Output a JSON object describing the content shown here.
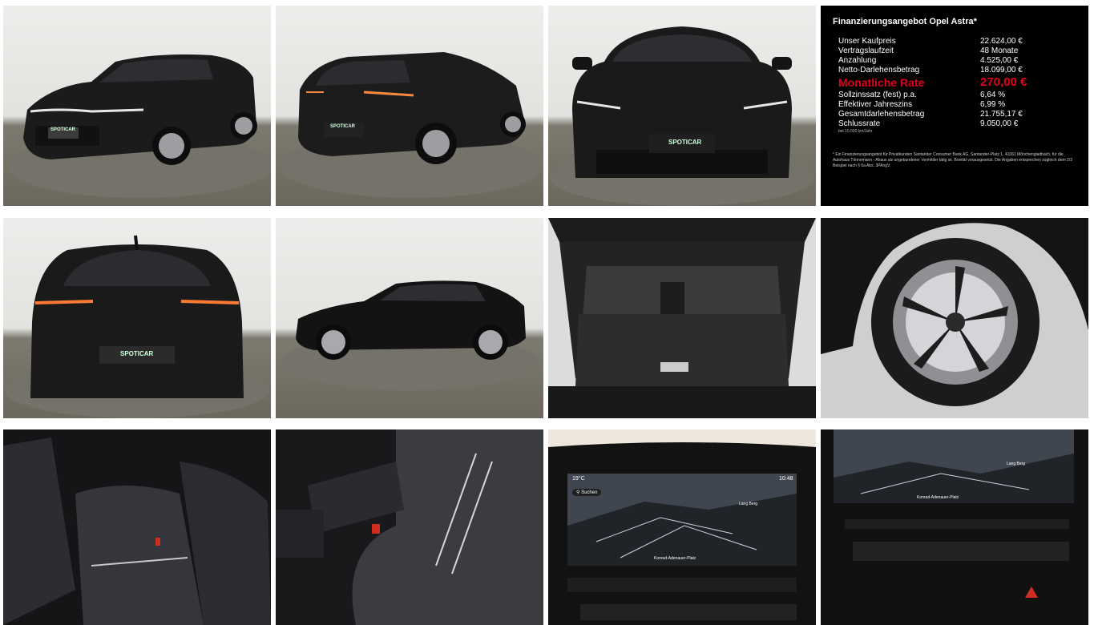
{
  "gallery": {
    "images": [
      {
        "label": "Opel Astra front three-quarter view"
      },
      {
        "label": "Opel Astra rear three-quarter view"
      },
      {
        "label": "Opel Astra front view"
      },
      {
        "label": "Financing offer"
      },
      {
        "label": "Opel Astra rear view"
      },
      {
        "label": "Opel Astra side view"
      },
      {
        "label": "Trunk"
      },
      {
        "label": "Alloy wheel"
      },
      {
        "label": "Rear seats"
      },
      {
        "label": "Front seat and center console"
      },
      {
        "label": "Infotainment screen"
      },
      {
        "label": "Navigation display"
      }
    ]
  },
  "plates": {
    "brand": "SPOTICAR"
  },
  "finance": {
    "title": "Finanzierungsangebot Opel Astra*",
    "rows_top": [
      {
        "key": "Unser Kaufpreis",
        "value": "22.624,00 €"
      },
      {
        "key": "Vertragslaufzeit",
        "value": "48 Monate"
      },
      {
        "key": "Anzahlung",
        "value": "4.525,00 €"
      },
      {
        "key": "Netto-Darlehensbetrag",
        "value": "18.099,00 €"
      }
    ],
    "rate": {
      "key": "Monatliche Rate",
      "value": "270,00 €"
    },
    "rows_bottom": [
      {
        "key": "Sollzinssatz (fest) p.a.",
        "value": "6,64 %"
      },
      {
        "key": "Effektiver Jahreszins",
        "value": "6,99 %"
      },
      {
        "key": "Gesamtdarlehensbetrag",
        "value": "21.755,17 €"
      },
      {
        "key": "Schlussrate",
        "value": "9.050,00 €"
      }
    ],
    "schlussrate_note": "bei 15.000 km/Jahr",
    "footnote": "* Ein Finanzierungsangebot für Privatkunden Santander Consumer Bank AG, Santander-Platz 1, 41061 Mönchengladbach, für die Autohaus Tönnemann - Ahaus als ungebundener Vermittler tätig ist. Bonität vorausgesetzt. Die Angaben entsprechen zugleich dem 2/3 Beispiel nach § 6a Abs. 3PAngV."
  },
  "infotainment": {
    "temperature": "19°C",
    "time": "10:48",
    "search_label": "Suchen",
    "street_label": "Konrad-Adenauer-Platz",
    "map_label": "Lang Berg"
  },
  "nav": {
    "street_label": "Konrad-Adenauer-Platz",
    "map_label": "Lang Berg"
  }
}
